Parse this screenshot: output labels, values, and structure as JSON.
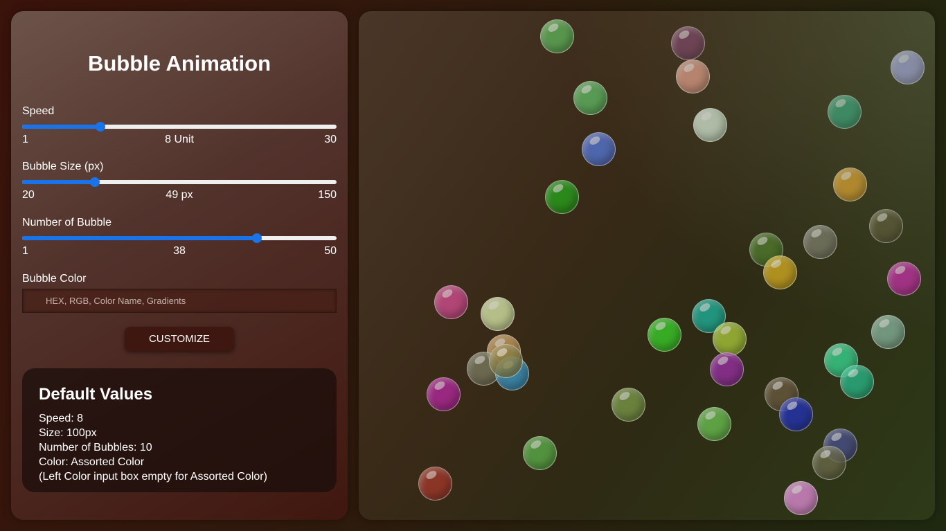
{
  "app": {
    "title": "Bubble Animation"
  },
  "controls": {
    "speed": {
      "label": "Speed",
      "min_label": "1",
      "max_label": "30",
      "value_label": "8 Unit",
      "min": 1,
      "max": 30,
      "value": 8
    },
    "size": {
      "label": "Bubble Size (px)",
      "min_label": "20",
      "max_label": "150",
      "value_label": "49 px",
      "min": 20,
      "max": 150,
      "value": 49
    },
    "count": {
      "label": "Number of Bubble",
      "min_label": "1",
      "max_label": "50",
      "value_label": "38",
      "min": 1,
      "max": 50,
      "value": 38
    },
    "color": {
      "label": "Bubble Color",
      "placeholder": "HEX, RGB, Color Name, Gradients",
      "value": ""
    }
  },
  "customize_button": {
    "label": "CUSTOMIZE"
  },
  "defaults": {
    "heading": "Default Values",
    "lines": [
      "Speed: 8",
      "Size: 100px",
      "Number of Bubbles: 10",
      "Color: Assorted Color",
      "(Left Color input box empty for Assorted Color)"
    ]
  },
  "accent_color": "#1a73e8",
  "bubble_colors": [
    "#5fb35a",
    "#7a3f63",
    "#e39b88",
    "#a7a6f0",
    "#5fba64",
    "#2fa37a",
    "#d8ead8",
    "#5577d6",
    "#e0a02a",
    "#27a31c",
    "#5a5535",
    "#4f7a2a",
    "#7b7a6a",
    "#d5ac20",
    "#c52ca5",
    "#d24d90",
    "#d8e8a8",
    "#1fb29b",
    "#3ad02a",
    "#a9c83a",
    "#86b19a",
    "#c79b5a",
    "#7a7a60",
    "#3a98c6",
    "#39d590",
    "#9a2fa5",
    "#b5289e",
    "#28b888",
    "#7b9a4a",
    "#6a5a40",
    "#2333b8",
    "#6bc252",
    "#5cb04a",
    "#4a4f8a",
    "#6a6a4a",
    "#a4392c",
    "#e08cd6",
    "#8a7f45"
  ]
}
